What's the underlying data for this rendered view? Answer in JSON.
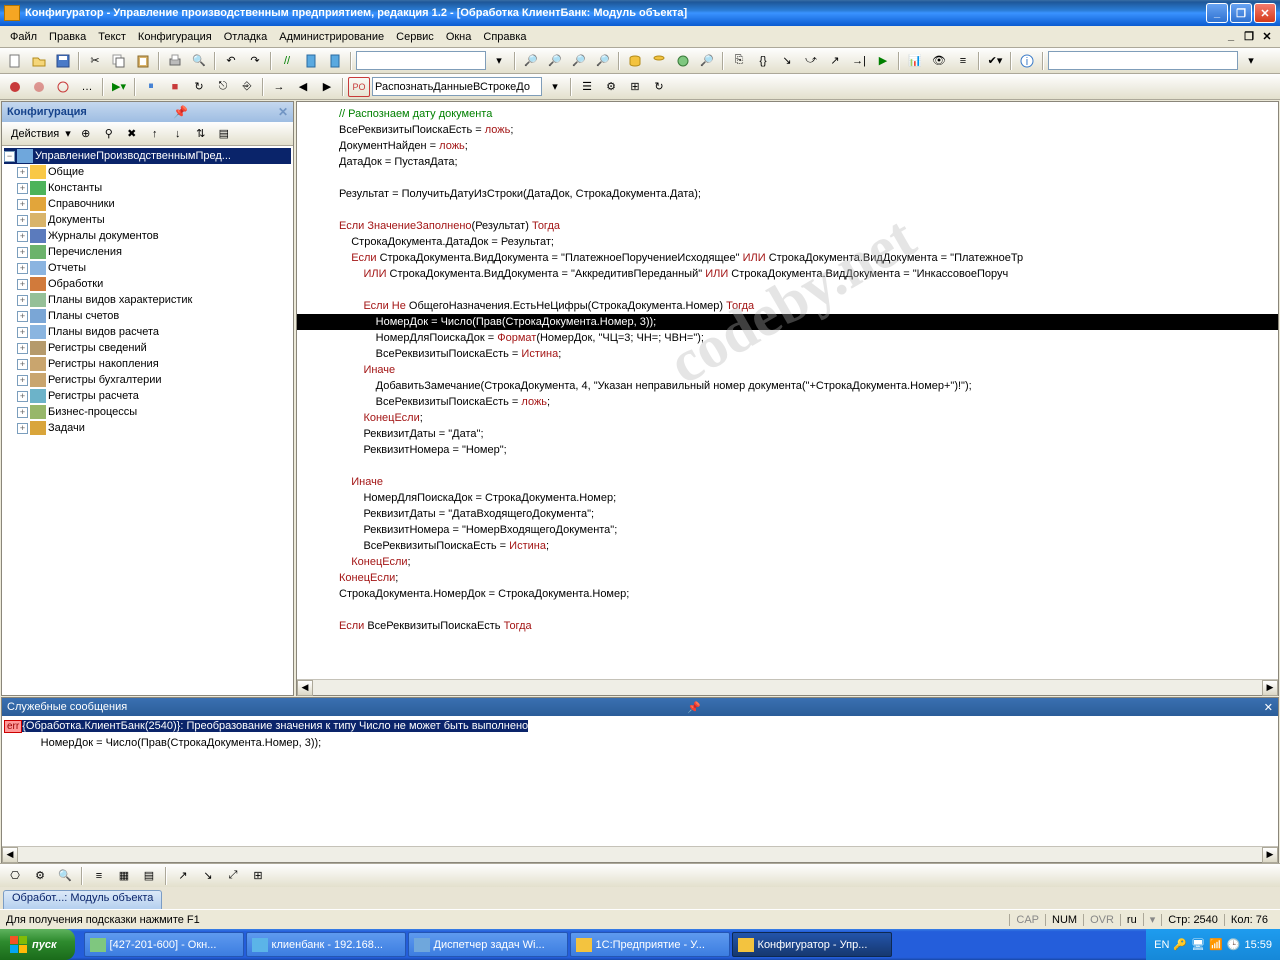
{
  "title": "Конфигуратор - Управление производственным предприятием, редакция 1.2 - [Обработка КлиентБанк: Модуль объекта]",
  "menu": [
    "Файл",
    "Правка",
    "Текст",
    "Конфигурация",
    "Отладка",
    "Администрирование",
    "Сервис",
    "Окна",
    "Справка"
  ],
  "toolbar2_proc": "РаспознатьДанныеВСтрокеДо",
  "sidebar": {
    "title": "Конфигурация",
    "actions_label": "Действия",
    "root": "УправлениеПроизводственнымПред...",
    "items": [
      {
        "label": "Общие",
        "icon": "#f9c846"
      },
      {
        "label": "Константы",
        "icon": "#4db35a"
      },
      {
        "label": "Справочники",
        "icon": "#e2a53a"
      },
      {
        "label": "Документы",
        "icon": "#d9b46a"
      },
      {
        "label": "Журналы документов",
        "icon": "#5b7bbd"
      },
      {
        "label": "Перечисления",
        "icon": "#6cb36c"
      },
      {
        "label": "Отчеты",
        "icon": "#8bb4e0"
      },
      {
        "label": "Обработки",
        "icon": "#d17a3b"
      },
      {
        "label": "Планы видов характеристик",
        "icon": "#95c098"
      },
      {
        "label": "Планы счетов",
        "icon": "#7aa6d6"
      },
      {
        "label": "Планы видов расчета",
        "icon": "#8ab5e0"
      },
      {
        "label": "Регистры сведений",
        "icon": "#b59a6c"
      },
      {
        "label": "Регистры накопления",
        "icon": "#c9a56e"
      },
      {
        "label": "Регистры бухгалтерии",
        "icon": "#c9a56e"
      },
      {
        "label": "Регистры расчета",
        "icon": "#6cb3c9"
      },
      {
        "label": "Бизнес-процессы",
        "icon": "#97b76a"
      },
      {
        "label": "Задачи",
        "icon": "#d9a53b"
      }
    ]
  },
  "messages": {
    "title": "Служебные сообщения",
    "err_prefix": "err",
    "err_line": "{Обработка.КлиентБанк(2540)}: Преобразование значения к типу Число не может быть выполнено",
    "err_code": "            НомерДок = Число(Прав(СтрокаДокумента.Номер, 3));"
  },
  "tab": "Обработ...: Модуль объекта",
  "status": {
    "hint": "Для получения подсказки нажмите F1",
    "cap": "CAP",
    "num": "NUM",
    "ovr": "OVR",
    "lang": "ru",
    "line_lbl": "Стр:",
    "line": "2540",
    "col_lbl": "Кол:",
    "col": "76"
  },
  "taskbar": {
    "start": "пуск",
    "items": [
      {
        "label": "[427-201-600] - Окн...",
        "active": false,
        "color": "#7fc77f"
      },
      {
        "label": "клиенбанк - 192.168...",
        "active": false,
        "color": "#5bb4e8"
      },
      {
        "label": "Диспетчер задач Wi...",
        "active": false,
        "color": "#6fa7dc"
      },
      {
        "label": "1С:Предприятие - У...",
        "active": false,
        "color": "#f3c33f"
      },
      {
        "label": "Конфигуратор - Упр...",
        "active": true,
        "color": "#f3c33f"
      }
    ],
    "lang": "EN",
    "time": "15:59"
  }
}
